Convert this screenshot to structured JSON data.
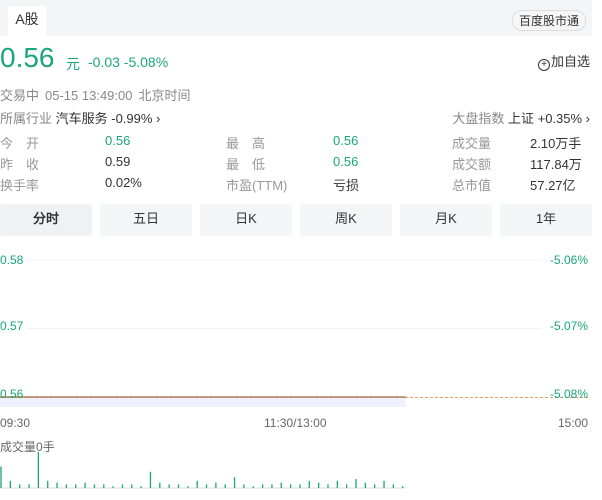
{
  "header": {
    "tab": "A股",
    "platform_button": "百度股市通"
  },
  "quote": {
    "price": "0.56",
    "unit": "元",
    "change": "-0.03 -5.08%",
    "add_watch": "加自选",
    "status": "交易中",
    "datetime": "05-15 13:49:00",
    "timezone": "北京时间",
    "industry_label": "所属行业",
    "industry": "汽车服务 -0.99% ›",
    "index_label": "大盘指数",
    "index": "上证 +0.35% ›"
  },
  "stats": [
    [
      {
        "label": "今　开",
        "value": "0.56"
      },
      {
        "label": "最　高",
        "value": "0.56"
      },
      {
        "label": "成交量",
        "value": "2.10万手"
      }
    ],
    [
      {
        "label": "昨　收",
        "value": "0.59"
      },
      {
        "label": "最　低",
        "value": "0.56"
      },
      {
        "label": "成交额",
        "value": "117.84万"
      }
    ],
    [
      {
        "label": "换手率",
        "value": "0.02%"
      },
      {
        "label": "市盈(TTM)",
        "value": "亏损"
      },
      {
        "label": "总市值",
        "value": "57.27亿"
      }
    ]
  ],
  "period_tabs": [
    "分时",
    "五日",
    "日K",
    "周K",
    "月K",
    "1年"
  ],
  "colors": {
    "green": "#1aa67a",
    "line": "#e8a06a"
  },
  "chart_data": {
    "type": "line",
    "y_ticks": [
      "0.58",
      "0.57",
      "0.56"
    ],
    "y_ticks_right": [
      "-5.06%",
      "-5.07%",
      "-5.08%"
    ],
    "x_ticks": [
      "09:30",
      "11:30/13:00",
      "15:00"
    ],
    "ylim": [
      0.56,
      0.58
    ],
    "price": 0.56,
    "session_progress": 0.69,
    "volume_label": "成交量0手",
    "volume_relative": [
      0.6,
      0.2,
      0.1,
      0.1,
      1,
      0.2,
      0.15,
      0.1,
      0.1,
      0.15,
      0.1,
      0.1,
      0.05,
      0.1,
      0.1,
      0.05,
      0.45,
      0.15,
      0.1,
      0.1,
      0.05,
      0.2,
      0.1,
      0.15,
      0.1,
      0.3,
      0.1,
      0.05,
      0.1,
      0.1,
      0.15,
      0.1,
      0.1,
      0.2,
      0.15,
      0.1,
      0.2,
      0.1,
      0.25,
      0.15,
      0.1,
      0.2,
      0.1,
      0.05
    ]
  }
}
